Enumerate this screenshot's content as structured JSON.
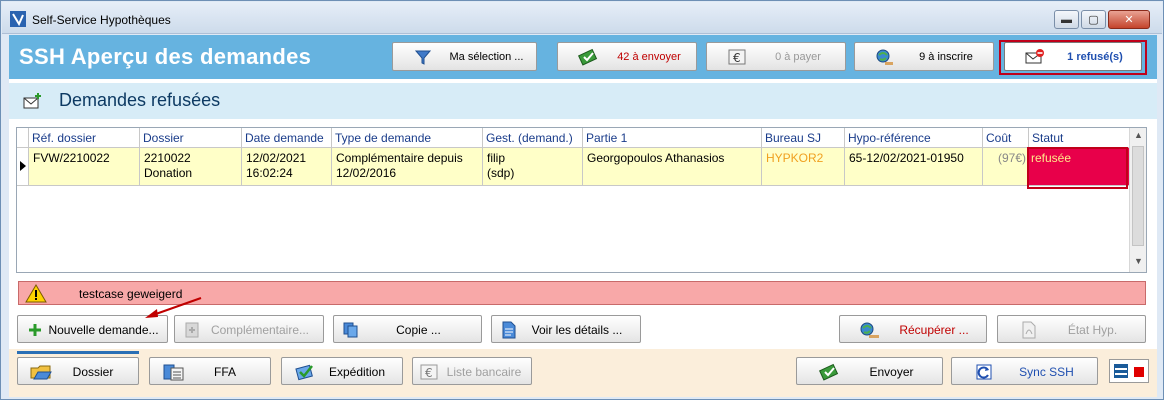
{
  "window": {
    "title": "Self-Service Hypothèques"
  },
  "header": {
    "app_title": "SSH  Aperçu des demandes",
    "buttons": {
      "selection": "Ma sélection ...",
      "to_send": "42 à envoyer",
      "to_pay": "0 à payer",
      "to_register": "9 à inscrire",
      "refused": "1 refusé(s)"
    }
  },
  "section": {
    "title": "Demandes refusées"
  },
  "grid": {
    "columns": [
      "Réf. dossier",
      "Dossier",
      "Date demande",
      "Type de demande",
      "Gest. (demand.)",
      "Partie 1",
      "Bureau SJ",
      "Hypo-référence",
      "Coût",
      "Statut"
    ],
    "row": {
      "ref_dossier": "FVW/2210022",
      "dossier_1": "2210022",
      "dossier_2": "Donation",
      "date_1": "12/02/2021",
      "date_2": "16:02:24",
      "type_1": "Complémentaire depuis",
      "type_2": "12/02/2016",
      "gest_1": "filip",
      "gest_2": "(sdp)",
      "partie1": "Georgopoulos Athanasios",
      "bureau": "HYPKOR2",
      "hypo_ref": "65-12/02/2021-01950",
      "cout": "(97€)",
      "statut": "refusée"
    }
  },
  "alert": {
    "message": "testcase geweigerd"
  },
  "actions": {
    "nouvelle": "Nouvelle demande...",
    "complementaire": "Complémentaire...",
    "copie": "Copie ...",
    "details": "Voir les détails ...",
    "recuperer": "Récupérer ...",
    "etat": "État Hyp."
  },
  "bottom": {
    "dossier": "Dossier",
    "ffa": "FFA",
    "expedition": "Expédition",
    "liste": "Liste bancaire",
    "envoyer": "Envoyer",
    "sync": "Sync SSH"
  },
  "colors": {
    "header": "#66b3e0",
    "row_highlight": "#ffffc8",
    "status_refused": "#e8004a",
    "alert_bg": "#f8a8a8"
  }
}
